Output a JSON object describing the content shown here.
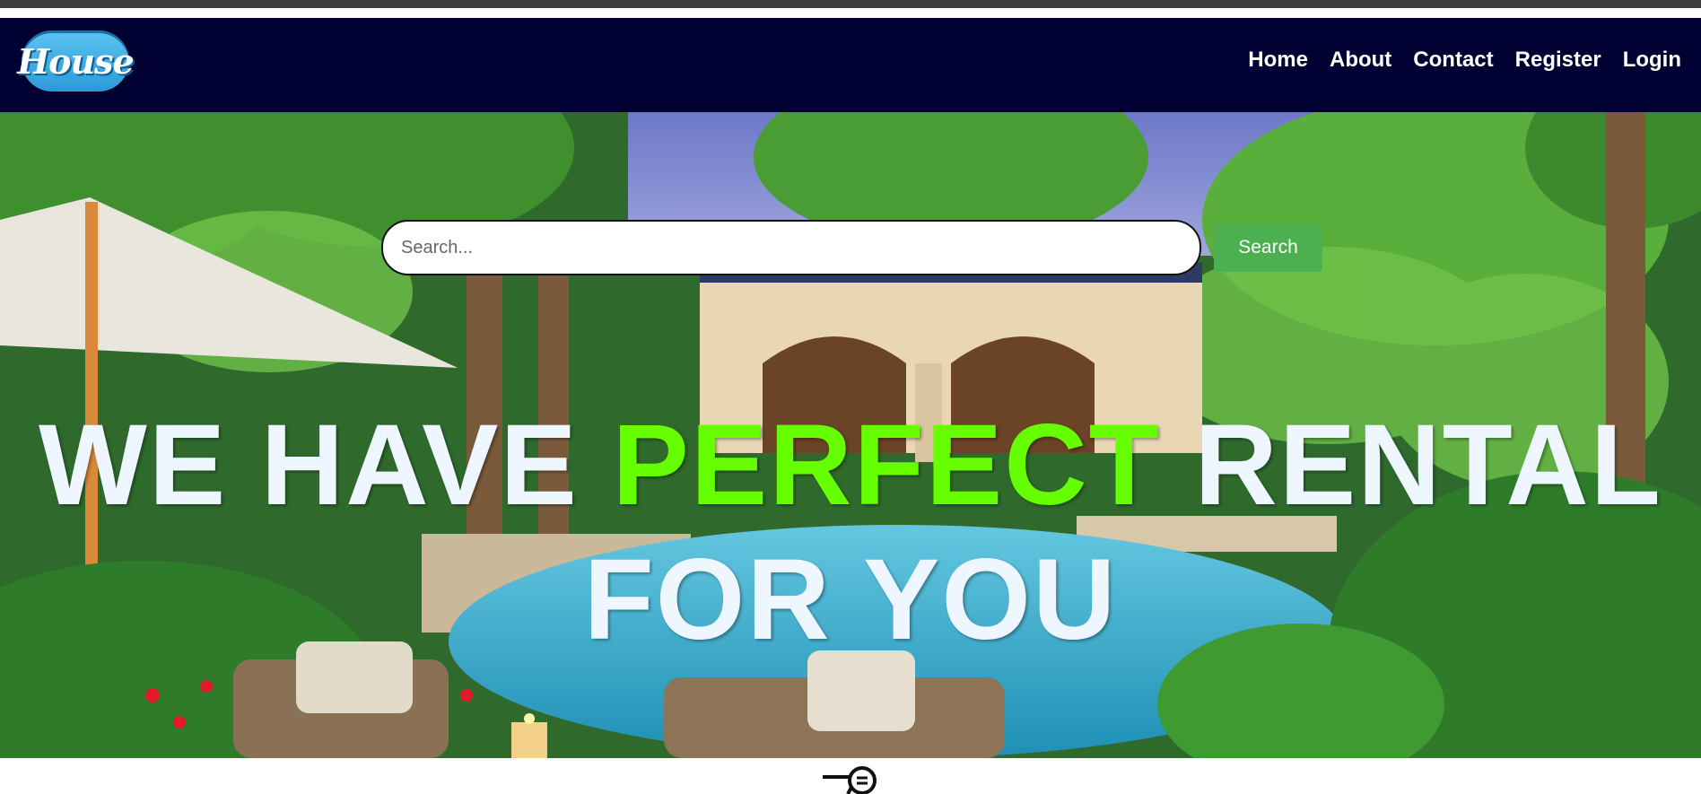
{
  "header": {
    "logo_text": "House",
    "nav": [
      "Home",
      "About",
      "Contact",
      "Register",
      "Login"
    ]
  },
  "search": {
    "placeholder": "Search...",
    "button_label": "Search"
  },
  "hero": {
    "line1_before": "WE HAVE",
    "line1_accent": "PERFECT",
    "line1_after": "RENTAL",
    "line2": "FOR YOU",
    "accent_color": "#66ff00"
  },
  "colors": {
    "navbar": "#000033",
    "search_button": "#4caf50",
    "logo": "#2a9ad8"
  },
  "icons": [
    "cursor-pointer-icon"
  ]
}
